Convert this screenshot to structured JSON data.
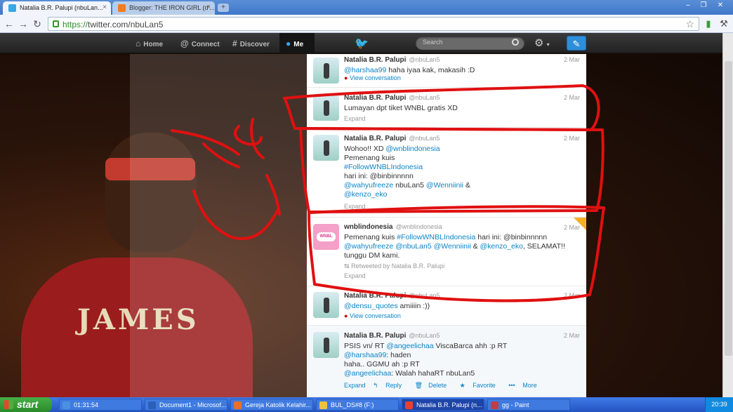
{
  "browser": {
    "tabs": [
      {
        "label": "Natalia B.R. Palupi (nbuLan...",
        "active": true
      },
      {
        "label": "Blogger: THE IRON GIRL (d'...",
        "active": false
      }
    ],
    "new_tab": "+",
    "url_scheme": "https://",
    "url_rest": "twitter.com/nbuLan5"
  },
  "twitter_nav": {
    "items": [
      {
        "label": "Home",
        "icon": "house-icon"
      },
      {
        "label": "Connect",
        "icon": "at-icon"
      },
      {
        "label": "Discover",
        "icon": "hash-icon"
      },
      {
        "label": "Me",
        "icon": "person-icon"
      }
    ],
    "search_placeholder": "Search"
  },
  "background": {
    "jersey_text": "JAMES"
  },
  "tweets": [
    {
      "name": "Natalia B.R. Palupi",
      "handle": "@nbuLan5",
      "date": "2 Mar",
      "lines": [
        [
          {
            "m": "@harshaa99"
          },
          {
            "t": " haha iyaa kak, makasih :D"
          }
        ]
      ],
      "meta": "View conversation",
      "meta_type": "conversation"
    },
    {
      "name": "Natalia B.R. Palupi",
      "handle": "@nbuLan5",
      "date": "2 Mar",
      "lines": [
        [
          {
            "t": "Lumayan dpt tiket WNBL gratis XD"
          }
        ]
      ],
      "meta": "Expand",
      "meta_type": "expand"
    },
    {
      "name": "Natalia B.R. Palupi",
      "handle": "@nbuLan5",
      "date": "2 Mar",
      "lines": [
        [
          {
            "t": "Wohoo!! XD "
          },
          {
            "m": "@wnblindonesia"
          }
        ],
        [
          {
            "t": "Pemenang kuis"
          }
        ],
        [
          {
            "m": "#FollowWNBLIndonesia"
          }
        ],
        [
          {
            "t": "hari ini: @binbinnnnn"
          }
        ],
        [
          {
            "m": "@wahyufreeze"
          },
          {
            "t": " nbuLan5 "
          },
          {
            "m": "@Wenniinii"
          },
          {
            "t": " &"
          }
        ],
        [
          {
            "m": "@kenzo_eko"
          }
        ]
      ],
      "meta": "Expand",
      "meta_type": "expand"
    },
    {
      "name": "wnblindonesia",
      "handle": "@wnblindonesia",
      "date": "2 Mar",
      "avatar_text": "WNBL",
      "lines": [
        [
          {
            "t": "Pemenang kuis "
          },
          {
            "m": "#FollowWNBLIndonesia"
          },
          {
            "t": " hari ini: @binbinnnnn"
          }
        ],
        [
          {
            "m": "@wahyufreeze"
          },
          {
            "t": " "
          },
          {
            "m": "@nbuLan5"
          },
          {
            "t": " "
          },
          {
            "m": "@Wenniinii"
          },
          {
            "t": " & "
          },
          {
            "m": "@kenzo_eko"
          },
          {
            "t": ", SELAMAT!!"
          }
        ],
        [
          {
            "t": "tunggu DM kami."
          }
        ]
      ],
      "retweeted": "Retweeted by Natalia B.R. Palupi",
      "meta": "Expand",
      "meta_type": "expand"
    },
    {
      "name": "Natalia B.R. Palupi",
      "handle": "@nbuLan5",
      "date": "2 Mar",
      "lines": [
        [
          {
            "m": "@densu_quotes"
          },
          {
            "t": " amiiiin :))"
          }
        ]
      ],
      "meta": "View conversation",
      "meta_type": "conversation"
    },
    {
      "name": "Natalia B.R. Palupi",
      "handle": "@nbuLan5",
      "date": "2 Mar",
      "lines": [
        [
          {
            "t": "PSIS vn/ RT "
          },
          {
            "m": "@angeelichaa"
          },
          {
            "t": " ViscaBarca ahh :p RT"
          }
        ],
        [
          {
            "m": "@harshaa99"
          },
          {
            "t": ": haden"
          }
        ],
        [
          {
            "t": "haha.. GGMU ah :p RT"
          }
        ],
        [
          {
            "m": "@angeelichaa"
          },
          {
            "t": ": Walah hahaRT nbuLan5"
          }
        ]
      ],
      "actions": [
        "Expand",
        "Reply",
        "Delete",
        "Favorite",
        "More"
      ]
    }
  ],
  "taskbar": {
    "start": "start",
    "items": [
      {
        "label": "01:31:54",
        "color": "#4a90e0"
      },
      {
        "label": "Document1 - Microsof...",
        "color": "#2b5fb8"
      },
      {
        "label": "Gereja Katolik Kelahir...",
        "color": "#e8702a"
      },
      {
        "label": "BUL_DS#8 (F:)",
        "color": "#f0c040"
      },
      {
        "label": "Natalia B.R. Palupi (n...",
        "color": "#e84030"
      },
      {
        "label": "gg - Paint",
        "color": "#c04040"
      }
    ],
    "clock": "20:39"
  }
}
